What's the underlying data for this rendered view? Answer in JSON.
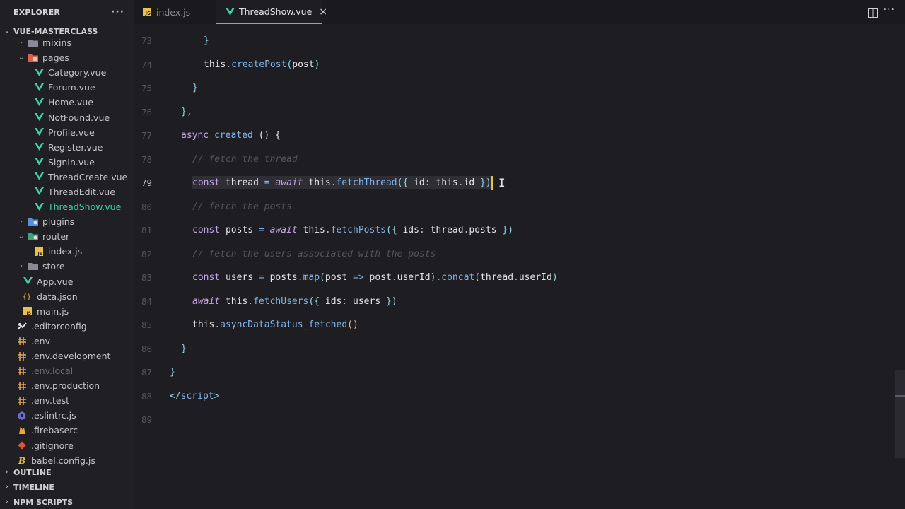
{
  "sidebar": {
    "title": "EXPLORER",
    "more": "···",
    "root": "VUE-MASTERCLASS",
    "items": [
      {
        "label": "mixins",
        "type": "folder",
        "icon": "folder-icon",
        "chev": "›"
      },
      {
        "label": "pages",
        "type": "folder-open",
        "icon": "pages-folder-icon",
        "chev": "⌄"
      },
      {
        "label": "Category.vue",
        "type": "vue",
        "icon": "vue-icon"
      },
      {
        "label": "Forum.vue",
        "type": "vue",
        "icon": "vue-icon"
      },
      {
        "label": "Home.vue",
        "type": "vue",
        "icon": "vue-icon"
      },
      {
        "label": "NotFound.vue",
        "type": "vue",
        "icon": "vue-icon"
      },
      {
        "label": "Profile.vue",
        "type": "vue",
        "icon": "vue-icon"
      },
      {
        "label": "Register.vue",
        "type": "vue",
        "icon": "vue-icon"
      },
      {
        "label": "SignIn.vue",
        "type": "vue",
        "icon": "vue-icon"
      },
      {
        "label": "ThreadCreate.vue",
        "type": "vue",
        "icon": "vue-icon"
      },
      {
        "label": "ThreadEdit.vue",
        "type": "vue",
        "icon": "vue-icon"
      },
      {
        "label": "ThreadShow.vue",
        "type": "vue",
        "icon": "vue-icon",
        "active": true
      },
      {
        "label": "plugins",
        "type": "folder",
        "icon": "plugins-folder-icon",
        "chev": "›"
      },
      {
        "label": "router",
        "type": "folder-open",
        "icon": "router-folder-icon",
        "chev": "⌄"
      },
      {
        "label": "index.js",
        "type": "js",
        "icon": "js-icon"
      },
      {
        "label": "store",
        "type": "folder",
        "icon": "folder-icon",
        "chev": "›"
      },
      {
        "label": "App.vue",
        "type": "vue",
        "icon": "vue-icon"
      },
      {
        "label": "data.json",
        "type": "json",
        "icon": "json-icon"
      },
      {
        "label": "main.js",
        "type": "js",
        "icon": "js-icon"
      },
      {
        "label": ".editorconfig",
        "type": "config",
        "icon": "editorconfig-icon"
      },
      {
        "label": ".env",
        "type": "env",
        "icon": "env-icon"
      },
      {
        "label": ".env.development",
        "type": "env",
        "icon": "env-icon"
      },
      {
        "label": ".env.local",
        "type": "env",
        "icon": "env-icon",
        "dim": true
      },
      {
        "label": ".env.production",
        "type": "env",
        "icon": "env-icon"
      },
      {
        "label": ".env.test",
        "type": "env",
        "icon": "env-icon"
      },
      {
        "label": ".eslintrc.js",
        "type": "eslint",
        "icon": "eslint-icon"
      },
      {
        "label": ".firebaserc",
        "type": "firebase",
        "icon": "firebase-icon"
      },
      {
        "label": ".gitignore",
        "type": "git",
        "icon": "git-icon"
      },
      {
        "label": "babel.config.js",
        "type": "babel",
        "icon": "babel-icon"
      }
    ],
    "sections": {
      "outline": "OUTLINE",
      "timeline": "TIMELINE",
      "npm": "NPM SCRIPTS"
    }
  },
  "tabs": [
    {
      "label": "index.js",
      "icon": "js-icon",
      "badge": "JS"
    },
    {
      "label": "ThreadShow.vue",
      "icon": "vue-icon",
      "active": true,
      "close": "×"
    }
  ],
  "editor": {
    "current_line": "79",
    "lines": [
      {
        "n": "73"
      },
      {
        "n": "74"
      },
      {
        "n": "75"
      },
      {
        "n": "76"
      },
      {
        "n": "77"
      },
      {
        "n": "78"
      },
      {
        "n": "79"
      },
      {
        "n": "80"
      },
      {
        "n": "81"
      },
      {
        "n": "82"
      },
      {
        "n": "83"
      },
      {
        "n": "84"
      },
      {
        "n": "85"
      },
      {
        "n": "86"
      },
      {
        "n": "87"
      },
      {
        "n": "88"
      },
      {
        "n": "89"
      }
    ],
    "tokens": {
      "l73": [
        "}"
      ],
      "l74": [
        "this",
        ".",
        "createPost",
        "(",
        "post",
        ")"
      ],
      "l75": [
        "}"
      ],
      "l76": [
        "}",
        ","
      ],
      "l77": [
        "async",
        " ",
        "created",
        " ",
        "()",
        " ",
        "{"
      ],
      "l78": [
        "// fetch the thread"
      ],
      "l79": [
        "const",
        " ",
        "thread",
        " ",
        "=",
        " ",
        "await",
        " ",
        "this",
        ".",
        "fetchThread",
        "(",
        "{",
        " ",
        "id",
        ":",
        " ",
        "this",
        ".",
        "id",
        " ",
        "}",
        ")"
      ],
      "l80": [
        "// fetch the posts"
      ],
      "l81": [
        "const",
        " ",
        "posts",
        " ",
        "=",
        " ",
        "await",
        " ",
        "this",
        ".",
        "fetchPosts",
        "(",
        "{",
        " ",
        "ids",
        ":",
        " ",
        "thread",
        ".",
        "posts",
        " ",
        "}",
        ")"
      ],
      "l82": [
        "// fetch the users associated with the posts"
      ],
      "l83": [
        "const",
        " ",
        "users",
        " ",
        "=",
        " ",
        "posts",
        ".",
        "map",
        "(",
        "post",
        " ",
        "=>",
        " ",
        "post",
        ".",
        "userId",
        ")",
        ".",
        "concat",
        "(",
        "thread",
        ".",
        "userId",
        ")"
      ],
      "l84": [
        "await",
        " ",
        "this",
        ".",
        "fetchUsers",
        "(",
        "{",
        " ",
        "ids",
        ":",
        " ",
        "users",
        " ",
        "}",
        ")"
      ],
      "l85": [
        "this",
        ".",
        "asyncDataStatus_fetched",
        "(",
        ")"
      ],
      "l86": [
        "}"
      ],
      "l87": [
        "}"
      ],
      "l88": [
        "</",
        "script",
        ">"
      ]
    }
  },
  "colors": {
    "accent": "#3fd2a0",
    "cursor": "#e8c04b",
    "background": "#1e1e22"
  }
}
